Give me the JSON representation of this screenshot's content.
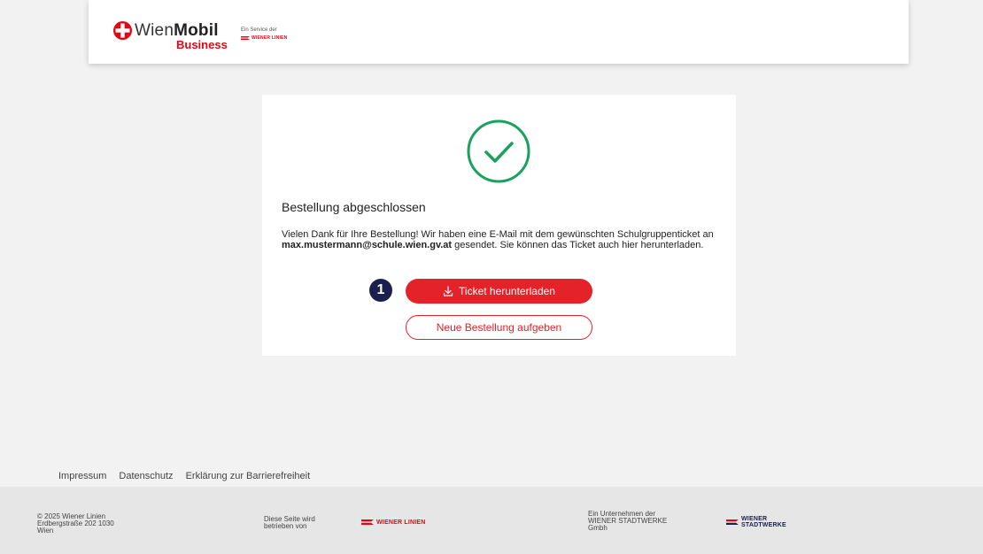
{
  "header": {
    "logo": {
      "wien": "Wien",
      "mobil": "Mobil",
      "business": "Business"
    },
    "service_text": "Ein Service der",
    "service_brand": "WIENER LINIEN"
  },
  "card": {
    "title": "Bestellung abgeschlossen",
    "message_part1": "Vielen Dank für Ihre Bestellung! Wir haben eine E-Mail mit dem gewünschten Schulgruppenticket an ",
    "email": "max.mustermann@schule.wien.gv.at",
    "message_part2": " gesendet. Sie können das Ticket auch hier herunterladen.",
    "step_number": "1",
    "download_label": "Ticket herunterladen",
    "new_order_label": "Neue Bestellung aufgeben"
  },
  "footer_links": [
    "Impressum",
    "Datenschutz",
    "Erklärung zur Barrierefreiheit"
  ],
  "footer": {
    "address_line1": "© 2025 Wiener Linien",
    "address_line2": "Erdbergstraße 202 1030",
    "address_line3": "Wien",
    "operated_line1": "Diese Seite wird",
    "operated_line2": "betrieben von",
    "operator_brand": "WIENER LINIEN",
    "company_line1": "Ein Unternehmen der",
    "company_line2": "WIENER STADTWERKE",
    "company_line3": "Gmbh",
    "parent_brand_line1": "WIENER",
    "parent_brand_line2": "STADTWERKE"
  },
  "colors": {
    "brand_red": "#e3222a",
    "success_green": "#1aa25c",
    "badge_navy": "#1a1f4e"
  }
}
